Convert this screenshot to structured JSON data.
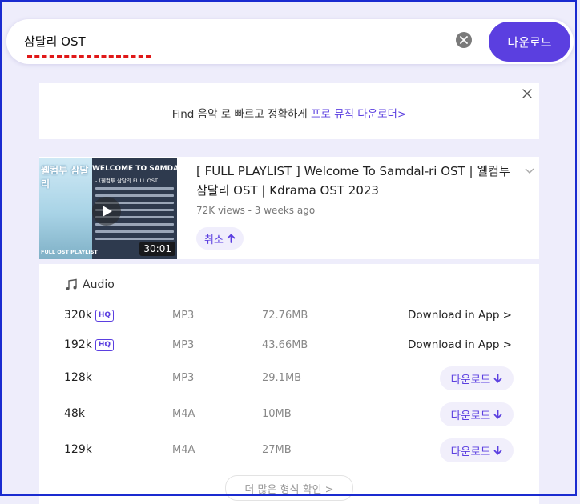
{
  "search": {
    "query": "삼달리 OST",
    "download_label": "다운로드"
  },
  "banner": {
    "text_prefix": "Find 음악 로 빠르고 정확하게 ",
    "link_text": "프로 뮤직 다운로더>"
  },
  "result": {
    "title": "[ FULL PLAYLIST ] Welcome To Samdal-ri OST | 웰컴투 삼달리 OST | Kdrama OST 2023",
    "meta": "72K views - 3 weeks ago",
    "cancel_label": "취소",
    "duration": "30:01",
    "thumb_title": "WELCOME TO SAMDAL",
    "thumb_sub": "- (웰컴투 삼달리 FULL OST",
    "thumb_foot": "FULL OST PLAYLIST",
    "thumb_logo": "웰컴투 삼달리"
  },
  "formats": {
    "section_label": "Audio",
    "rows": [
      {
        "quality": "320k",
        "hq": "HQ",
        "format": "MP3",
        "size": "72.76MB",
        "action": "Download in App >"
      },
      {
        "quality": "192k",
        "hq": "HQ",
        "format": "MP3",
        "size": "43.66MB",
        "action": "Download in App >"
      },
      {
        "quality": "128k",
        "format": "MP3",
        "size": "29.1MB",
        "action": "다운로드"
      },
      {
        "quality": "48k",
        "format": "M4A",
        "size": "10MB",
        "action": "다운로드"
      },
      {
        "quality": "129k",
        "format": "M4A",
        "size": "27MB",
        "action": "다운로드"
      }
    ],
    "more_label": "더 많은 형식 확인 >"
  }
}
